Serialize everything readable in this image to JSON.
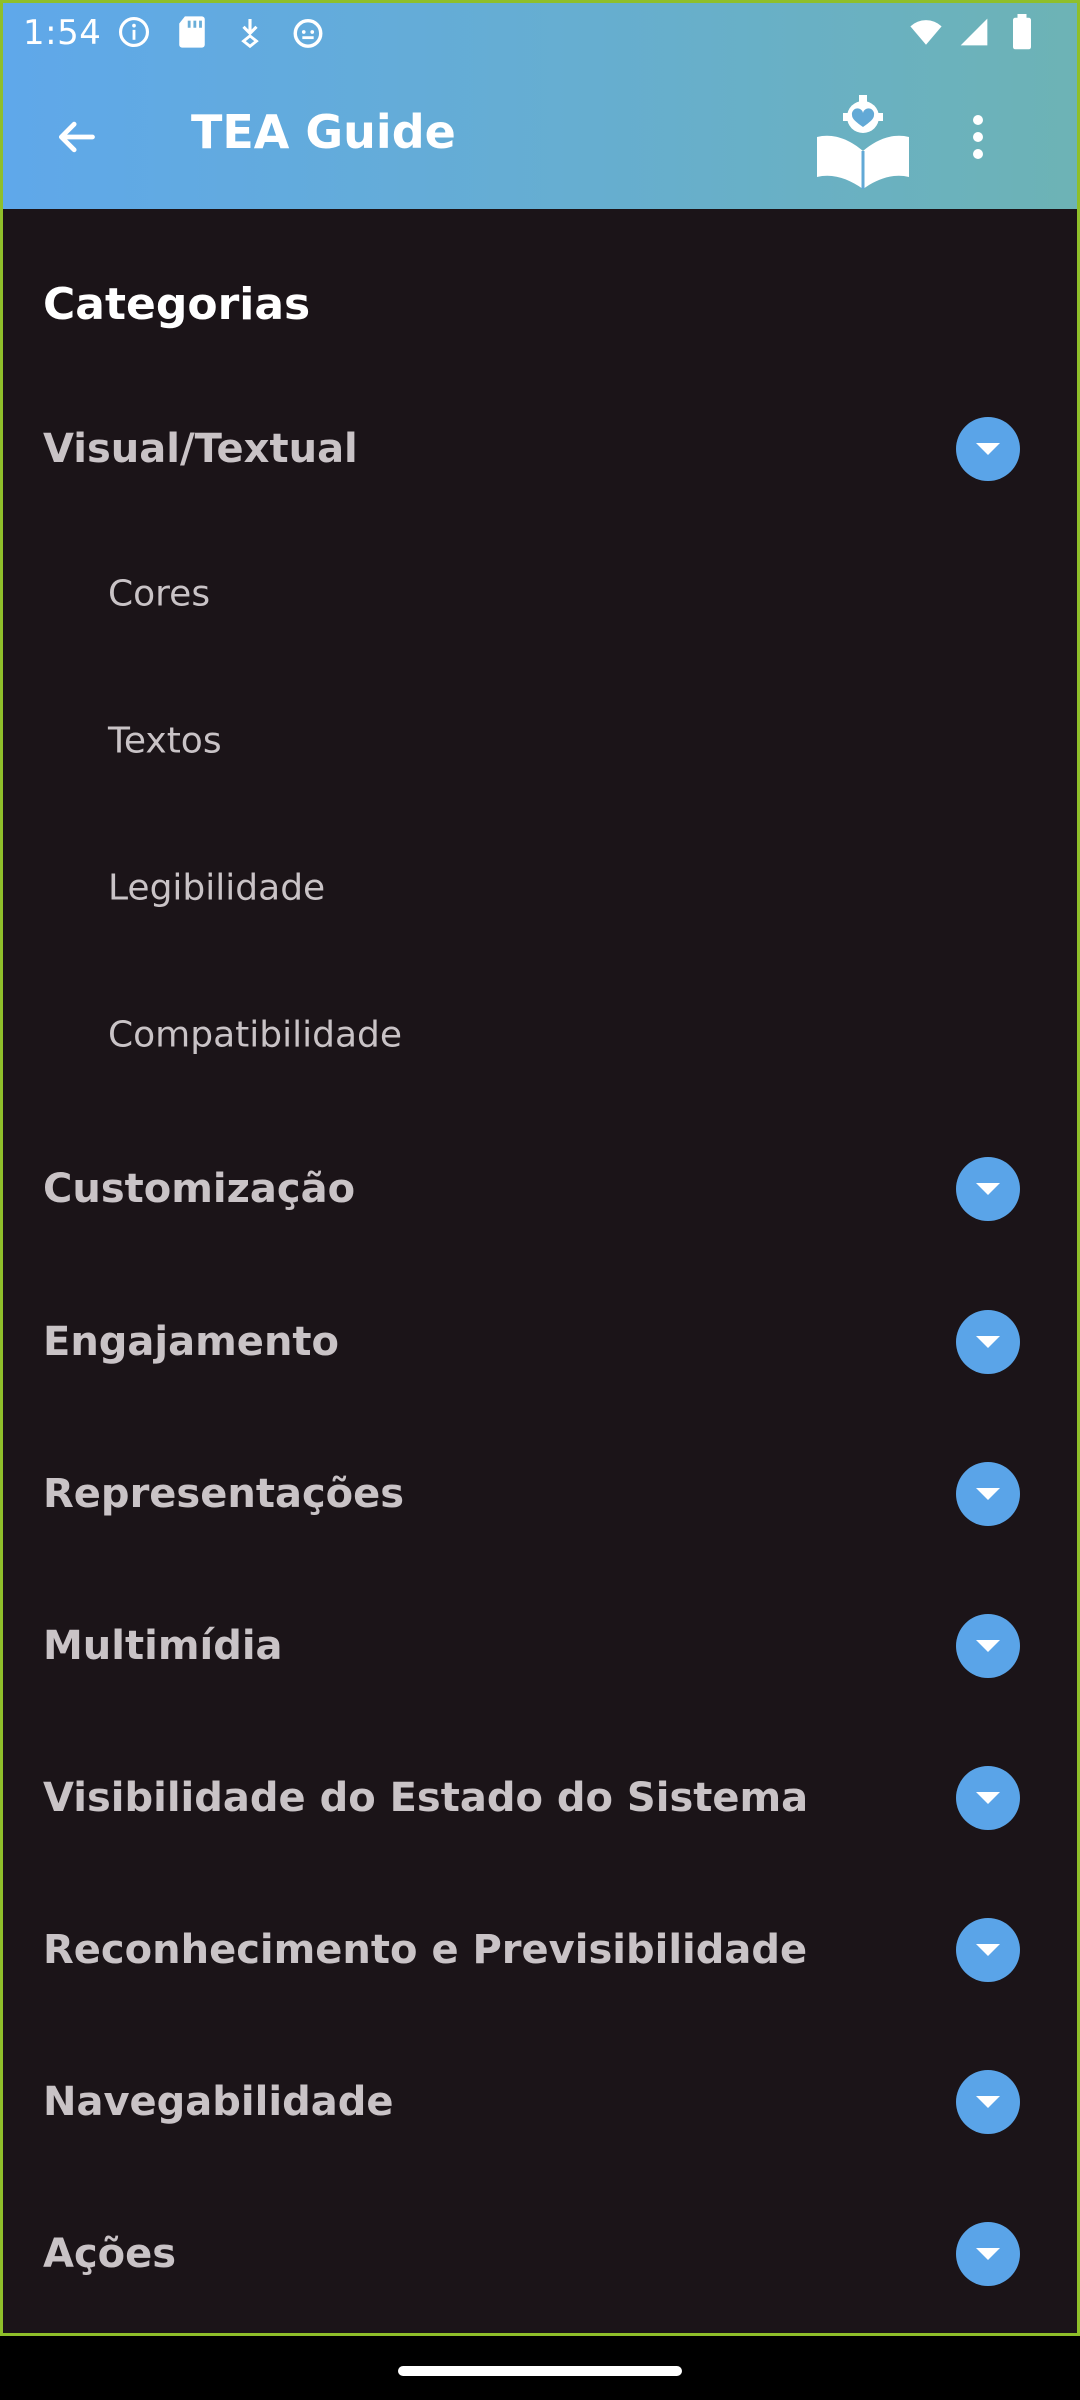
{
  "status_bar": {
    "time": "1:54",
    "left_icons": [
      "info-icon",
      "sd-card-icon",
      "download-icon",
      "android-icon"
    ],
    "right_icons": [
      "wifi-icon",
      "signal-icon",
      "battery-icon"
    ]
  },
  "app_bar": {
    "title": "TEA Guide",
    "back_icon": "arrow-left-icon",
    "logo_icon": "book-puzzle-heart-icon",
    "menu_icon": "more-vertical-icon"
  },
  "section_title": "Categorias",
  "categories": [
    {
      "label": "Visual/Textual",
      "expanded": true,
      "subitems": [
        "Cores",
        "Textos",
        "Legibilidade",
        "Compatibilidade"
      ]
    },
    {
      "label": "Customização",
      "expanded": false
    },
    {
      "label": "Engajamento",
      "expanded": false
    },
    {
      "label": "Representações",
      "expanded": false
    },
    {
      "label": "Multimídia",
      "expanded": false
    },
    {
      "label": "Visibilidade do Estado do Sistema",
      "expanded": false
    },
    {
      "label": "Reconhecimento e Previsibilidade",
      "expanded": false
    },
    {
      "label": "Navegabilidade",
      "expanded": false
    },
    {
      "label": "Ações",
      "expanded": false
    }
  ],
  "colors": {
    "app_bar_gradient_start": "#5fa8ea",
    "app_bar_gradient_end": "#6db3b5",
    "background": "#1b1418",
    "accent": "#5aa4e8",
    "text_muted": "#c9c3c6"
  }
}
